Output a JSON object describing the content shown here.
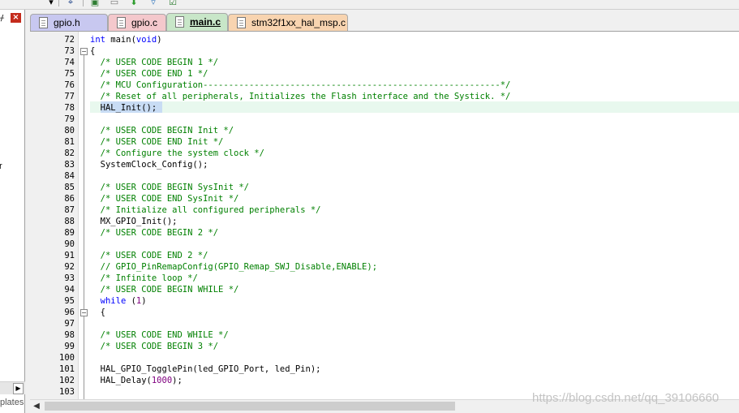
{
  "toolbar": {
    "icons": [
      "dropdown-icon",
      "debug-icon",
      "window-icon",
      "window-icon",
      "download-icon",
      "options-icon",
      "check-icon"
    ]
  },
  "left_panel": {
    "close_glyph": "×",
    "truncated_text": "r",
    "bottom_tab": "plates",
    "scroll_glyph": "▶"
  },
  "tabs": [
    {
      "label": "gpio.h",
      "color": "#c8c8f0"
    },
    {
      "label": "gpio.c",
      "color": "#f4c8cc"
    },
    {
      "label": "main.c",
      "color": "#c8e6c8",
      "active": true
    },
    {
      "label": "stm32f1xx_hal_msp.c",
      "color": "#f8d4b0"
    }
  ],
  "editor": {
    "lines": [
      {
        "n": "72",
        "parts": [
          [
            "kw",
            "int"
          ],
          [
            "plain",
            " main("
          ],
          [
            "kw",
            "void"
          ],
          [
            "plain",
            ")"
          ]
        ]
      },
      {
        "n": "73",
        "parts": [
          [
            "plain",
            "{"
          ]
        ]
      },
      {
        "n": "74",
        "parts": [
          [
            "plain",
            "  "
          ],
          [
            "cmt",
            "/* USER CODE BEGIN 1 */"
          ]
        ]
      },
      {
        "n": "75",
        "parts": [
          [
            "plain",
            "  "
          ],
          [
            "cmt",
            "/* USER CODE END 1 */"
          ]
        ]
      },
      {
        "n": "76",
        "parts": [
          [
            "plain",
            "  "
          ],
          [
            "cmt",
            "/* MCU Configuration----------------------------------------------------------*/"
          ]
        ]
      },
      {
        "n": "77",
        "parts": [
          [
            "plain",
            "  "
          ],
          [
            "cmt",
            "/* Reset of all peripherals, Initializes the Flash interface and the Systick. */"
          ]
        ]
      },
      {
        "n": "78",
        "parts": [
          [
            "plain",
            "  HAL_Init();"
          ]
        ]
      },
      {
        "n": "79",
        "parts": [
          [
            "plain",
            ""
          ]
        ]
      },
      {
        "n": "80",
        "parts": [
          [
            "plain",
            "  "
          ],
          [
            "cmt",
            "/* USER CODE BEGIN Init */"
          ]
        ]
      },
      {
        "n": "81",
        "parts": [
          [
            "plain",
            "  "
          ],
          [
            "cmt",
            "/* USER CODE END Init */"
          ]
        ]
      },
      {
        "n": "82",
        "parts": [
          [
            "plain",
            "  "
          ],
          [
            "cmt",
            "/* Configure the system clock */"
          ]
        ]
      },
      {
        "n": "83",
        "parts": [
          [
            "plain",
            "  SystemClock_Config();"
          ]
        ]
      },
      {
        "n": "84",
        "parts": [
          [
            "plain",
            ""
          ]
        ]
      },
      {
        "n": "85",
        "parts": [
          [
            "plain",
            "  "
          ],
          [
            "cmt",
            "/* USER CODE BEGIN SysInit */"
          ]
        ]
      },
      {
        "n": "86",
        "parts": [
          [
            "plain",
            "  "
          ],
          [
            "cmt",
            "/* USER CODE END SysInit */"
          ]
        ]
      },
      {
        "n": "87",
        "parts": [
          [
            "plain",
            "  "
          ],
          [
            "cmt",
            "/* Initialize all configured peripherals */"
          ]
        ]
      },
      {
        "n": "88",
        "parts": [
          [
            "plain",
            "  MX_GPIO_Init();"
          ]
        ]
      },
      {
        "n": "89",
        "parts": [
          [
            "plain",
            "  "
          ],
          [
            "cmt",
            "/* USER CODE BEGIN 2 */"
          ]
        ]
      },
      {
        "n": "90",
        "parts": [
          [
            "plain",
            ""
          ]
        ]
      },
      {
        "n": "91",
        "parts": [
          [
            "plain",
            "  "
          ],
          [
            "cmt",
            "/* USER CODE END 2 */"
          ]
        ]
      },
      {
        "n": "92",
        "parts": [
          [
            "plain",
            "  "
          ],
          [
            "cmt",
            "// GPIO_PinRemapConfig(GPIO_Remap_SWJ_Disable,ENABLE);"
          ]
        ]
      },
      {
        "n": "93",
        "parts": [
          [
            "plain",
            "  "
          ],
          [
            "cmt",
            "/* Infinite loop */"
          ]
        ]
      },
      {
        "n": "94",
        "parts": [
          [
            "plain",
            "  "
          ],
          [
            "cmt",
            "/* USER CODE BEGIN WHILE */"
          ]
        ]
      },
      {
        "n": "95",
        "parts": [
          [
            "plain",
            "  "
          ],
          [
            "kw",
            "while"
          ],
          [
            "plain",
            " ("
          ],
          [
            "num",
            "1"
          ],
          [
            "plain",
            ")"
          ]
        ]
      },
      {
        "n": "96",
        "parts": [
          [
            "plain",
            "  {"
          ]
        ]
      },
      {
        "n": "97",
        "parts": [
          [
            "plain",
            ""
          ]
        ]
      },
      {
        "n": "98",
        "parts": [
          [
            "plain",
            "  "
          ],
          [
            "cmt",
            "/* USER CODE END WHILE */"
          ]
        ]
      },
      {
        "n": "99",
        "parts": [
          [
            "plain",
            "  "
          ],
          [
            "cmt",
            "/* USER CODE BEGIN 3 */"
          ]
        ]
      },
      {
        "n": "100",
        "parts": [
          [
            "plain",
            ""
          ]
        ]
      },
      {
        "n": "101",
        "parts": [
          [
            "plain",
            "  HAL_GPIO_TogglePin(led_GPIO_Port, led_Pin);"
          ]
        ]
      },
      {
        "n": "102",
        "parts": [
          [
            "plain",
            "  HAL_Delay("
          ],
          [
            "num",
            "1000"
          ],
          [
            "plain",
            ");"
          ]
        ]
      },
      {
        "n": "103",
        "parts": [
          [
            "plain",
            ""
          ]
        ]
      }
    ]
  },
  "scrollbar": {
    "left_glyph": "◀"
  },
  "watermark": "https://blog.csdn.net/qq_39106660"
}
